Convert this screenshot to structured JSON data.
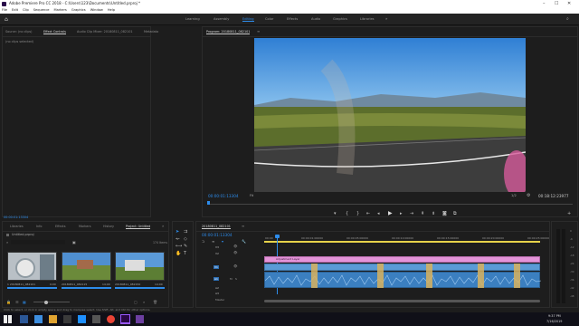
{
  "titlebar": {
    "title": "Adobe Premiere Pro CC 2018 - C:\\Users\\123\\Documents\\Untitled.prproj *"
  },
  "menu": [
    "File",
    "Edit",
    "Clip",
    "Sequence",
    "Markers",
    "Graphics",
    "Window",
    "Help"
  ],
  "workspaces": [
    {
      "label": "Learning",
      "active": false
    },
    {
      "label": "Assembly",
      "active": false
    },
    {
      "label": "Editing",
      "active": true
    },
    {
      "label": "Color",
      "active": false
    },
    {
      "label": "Effects",
      "active": false
    },
    {
      "label": "Audio",
      "active": false
    },
    {
      "label": "Graphics",
      "active": false
    },
    {
      "label": "Libraries",
      "active": false
    }
  ],
  "source_panel": {
    "tabs": [
      "Source: (no clips)",
      "Effect Controls",
      "Audio Clip Mixer: 20180811_082101",
      "Metadata"
    ],
    "active_tab": 1,
    "empty_text": "(no clips selected)",
    "footer_time": "00:00:01:13304"
  },
  "program_panel": {
    "title": "Program: 20180811_082101",
    "current_time": "00:00:01:13304",
    "zoom": "Fit",
    "resolution": "1/2",
    "duration": "00:18:12:23977"
  },
  "project_panel": {
    "tabs": [
      "Libraries",
      "Info",
      "Effects",
      "Markers",
      "History",
      "Project: Untitled"
    ],
    "active_tab": 5,
    "file": "Untitled.prproj",
    "item_count": "174 Items",
    "thumbnails": [
      {
        "name": "1 20180811_082101",
        "dur": "0;00"
      },
      {
        "name": "20180811_082115",
        "dur": "14;00"
      },
      {
        "name": "20180811_082150",
        "dur": "14;00"
      }
    ]
  },
  "timeline": {
    "sequence_tab": "20180811_082101",
    "current_time": "00:00:01:13304",
    "ruler": [
      "00:00",
      "00:00:01:00000",
      "00:00:05:00000",
      "00:00:10:00000",
      "00:00:15:00000",
      "00:00:20:00000",
      "00:00:25:00000",
      "00:00:30:00000"
    ],
    "tracks": [
      "V3",
      "V2",
      "V1",
      "A1",
      "A2",
      "A3"
    ],
    "adjustment_clip": "Adjustment Layer",
    "master_label": "Master"
  },
  "meter_scale": [
    "0",
    "-6",
    "-12",
    "-18",
    "-24",
    "-30",
    "-36",
    "-42",
    "-48",
    "-54"
  ],
  "status": "Click to select, or click in empty space and drag to marquee select. Use Shift, Alt, and Ctrl for other options.",
  "taskbar": {
    "time": "9:37 PM",
    "date": "7/16/2019"
  },
  "colors": {
    "accent": "#2d8ceb",
    "adjustment": "#e394d8",
    "video_clip": "#5a9bd6",
    "audio_clip": "#3b7fc0",
    "playhead": "#2d8ceb"
  }
}
